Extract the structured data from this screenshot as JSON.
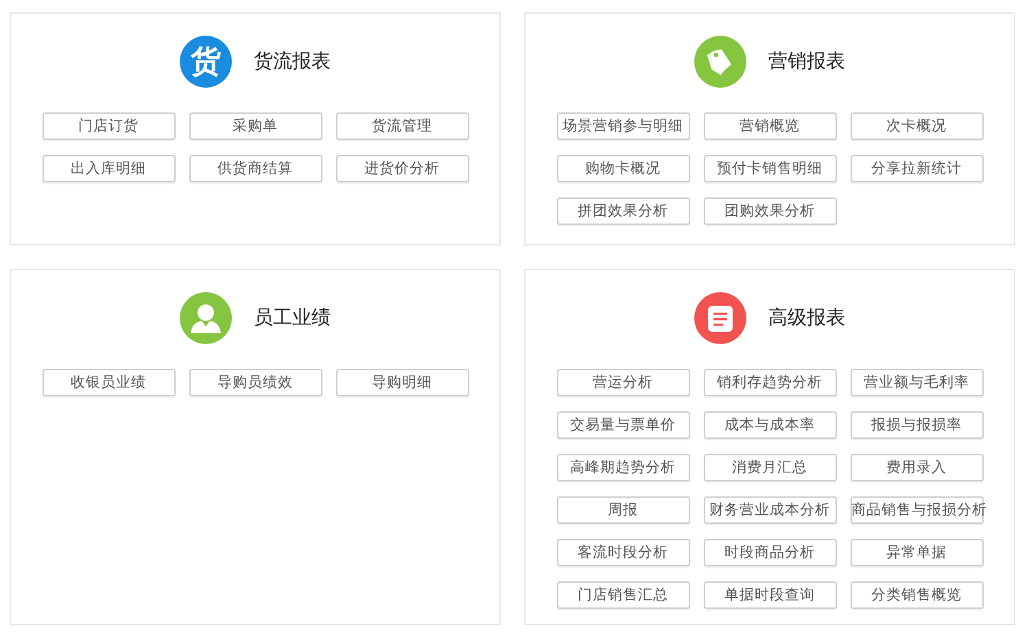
{
  "sections": [
    {
      "title": "货流报表",
      "icon": {
        "kind": "glyph",
        "glyph": "货"
      },
      "color": "#1a8ce0",
      "items": [
        "门店订货",
        "采购单",
        "货流管理",
        "出入库明细",
        "供货商结算",
        "进货价分析"
      ]
    },
    {
      "title": "营销报表",
      "icon": {
        "kind": "tag"
      },
      "color": "#85c540",
      "items": [
        "场景营销参与明细",
        "营销概览",
        "次卡概况",
        "购物卡概况",
        "预付卡销售明细",
        "分享拉新统计",
        "拼团效果分析",
        "团购效果分析"
      ]
    },
    {
      "title": "员工业绩",
      "icon": {
        "kind": "person"
      },
      "color": "#85c540",
      "items": [
        "收银员业绩",
        "导购员绩效",
        "导购明细"
      ]
    },
    {
      "title": "高级报表",
      "icon": {
        "kind": "document"
      },
      "color": "#f25350",
      "items": [
        "营运分析",
        "销利存趋势分析",
        "营业额与毛利率",
        "交易量与票单价",
        "成本与成本率",
        "报损与报损率",
        "高峰期趋势分析",
        "消费月汇总",
        "费用录入",
        "周报",
        "财务营业成本分析",
        "商品销售与报损分析",
        "客流时段分析",
        "时段商品分析",
        "异常单据",
        "门店销售汇总",
        "单据时段查询",
        "分类销售概览"
      ]
    }
  ]
}
